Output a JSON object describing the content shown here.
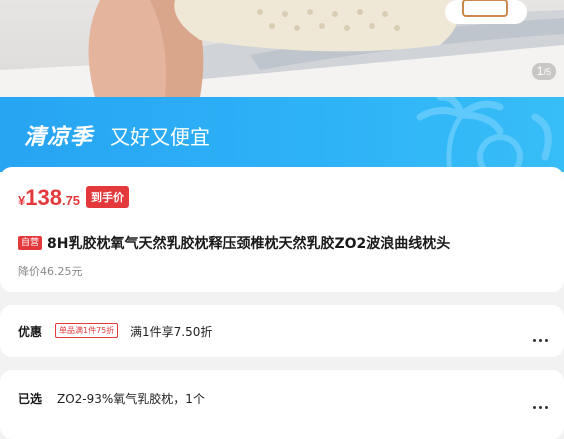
{
  "gallery": {
    "current": "1",
    "total": "/5"
  },
  "banner": {
    "title": "清凉季",
    "subtitle": "又好又便宜"
  },
  "price": {
    "currency": "¥",
    "integer": "138",
    "decimal": ".75",
    "tag": "到手价"
  },
  "product": {
    "badge": "自营",
    "title": "8H乳胶枕氧气天然乳胶枕释压颈椎枕天然乳胶ZO2波浪曲线枕头",
    "original_price": "降价46.25元"
  },
  "promotion": {
    "label": "优惠",
    "coupon": "单品满1件75折",
    "text": "满1件享7.50折"
  },
  "selection": {
    "label": "已选",
    "text": "ZO2-93%氧气乳胶枕，1个"
  },
  "colors": {
    "accent_red": "#e4393c",
    "banner_blue": "#2eb2f7"
  }
}
